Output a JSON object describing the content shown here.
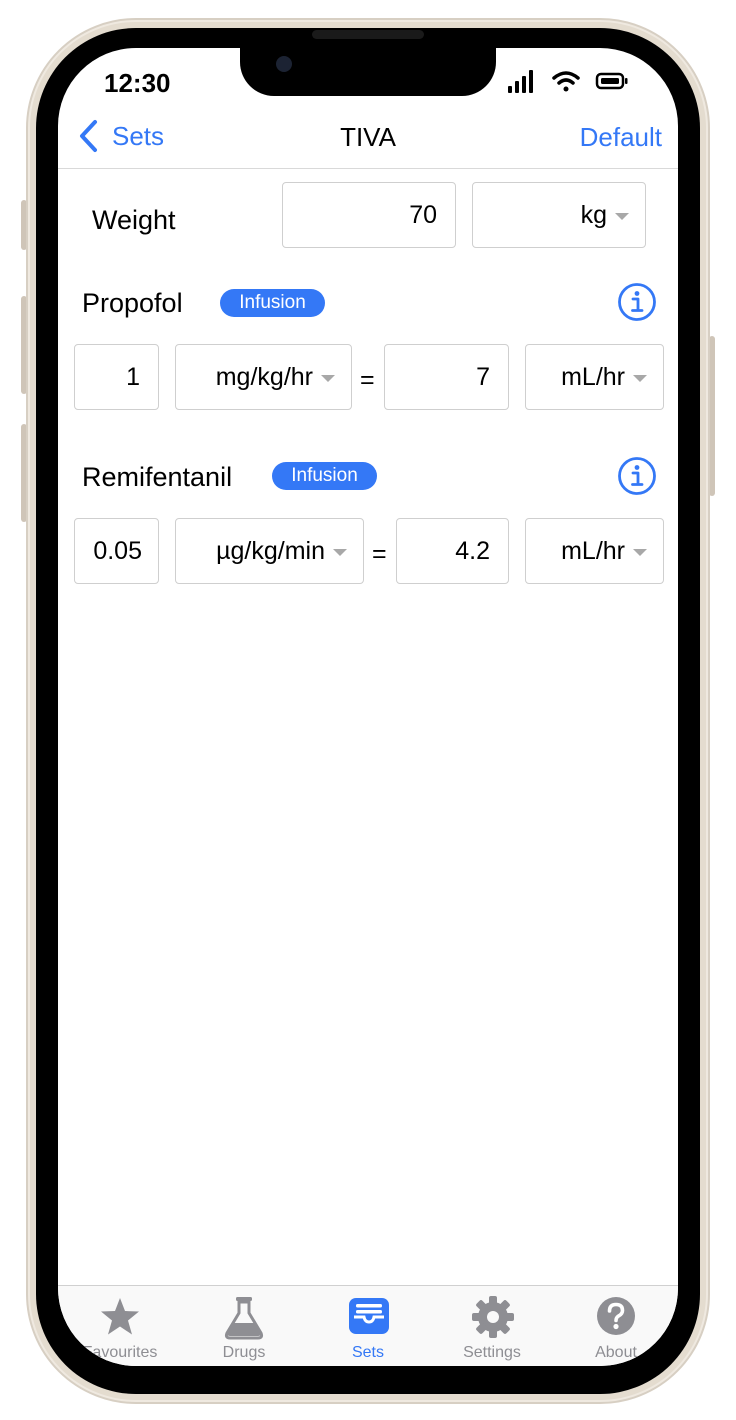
{
  "status_bar": {
    "time": "12:30"
  },
  "nav": {
    "back_label": "Sets",
    "title": "TIVA",
    "right_action": "Default"
  },
  "weight": {
    "label": "Weight",
    "value": "70",
    "unit": "kg"
  },
  "drugs": [
    {
      "name": "Propofol",
      "badge": "Infusion",
      "dose": "1",
      "dose_unit": "mg/kg/hr",
      "equals": "=",
      "rate": "7",
      "rate_unit": "mL/hr"
    },
    {
      "name": "Remifentanil",
      "badge": "Infusion",
      "dose": "0.05",
      "dose_unit": "µg/kg/min",
      "equals": "=",
      "rate": "4.2",
      "rate_unit": "mL/hr"
    }
  ],
  "tabs": [
    {
      "label": "Favourites",
      "icon": "star-icon",
      "active": false
    },
    {
      "label": "Drugs",
      "icon": "flask-icon",
      "active": false
    },
    {
      "label": "Sets",
      "icon": "tray-icon",
      "active": true
    },
    {
      "label": "Settings",
      "icon": "gear-icon",
      "active": false
    },
    {
      "label": "About",
      "icon": "question-icon",
      "active": false
    }
  ],
  "colors": {
    "accent": "#3478f6",
    "inactive": "#8e8e93"
  }
}
